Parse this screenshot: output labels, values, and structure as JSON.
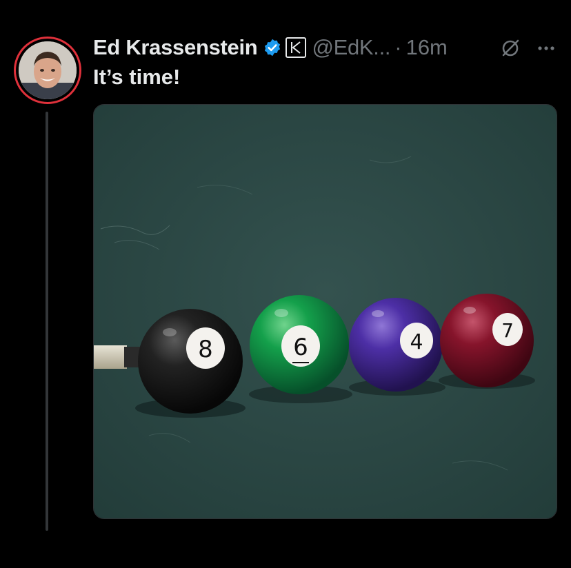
{
  "tweet": {
    "author": {
      "display_name": "Ed Krassenstein",
      "handle": "@EdK...",
      "verified": true,
      "affiliate_badge_letter": "K"
    },
    "separator": "·",
    "timestamp": "16m",
    "text": "It’s time!",
    "media": {
      "kind": "photo",
      "balls": [
        {
          "number": "8",
          "color": "#1b1b1b"
        },
        {
          "number": "6",
          "color": "#0f8a3e"
        },
        {
          "number": "4",
          "color": "#4a2a9a"
        },
        {
          "number": "7",
          "color": "#7a1024"
        }
      ]
    },
    "icons": {
      "verified": "verified-badge-icon",
      "affiliate": "affiliate-k-icon",
      "grok": "grok-icon",
      "more": "more-options-icon"
    }
  },
  "colors": {
    "background": "#000000",
    "text_primary": "#e7e9ea",
    "text_secondary": "#71767b",
    "verified_blue": "#1d9bf0",
    "avatar_ring": "#e0313b",
    "felt": "#2c4a47"
  }
}
